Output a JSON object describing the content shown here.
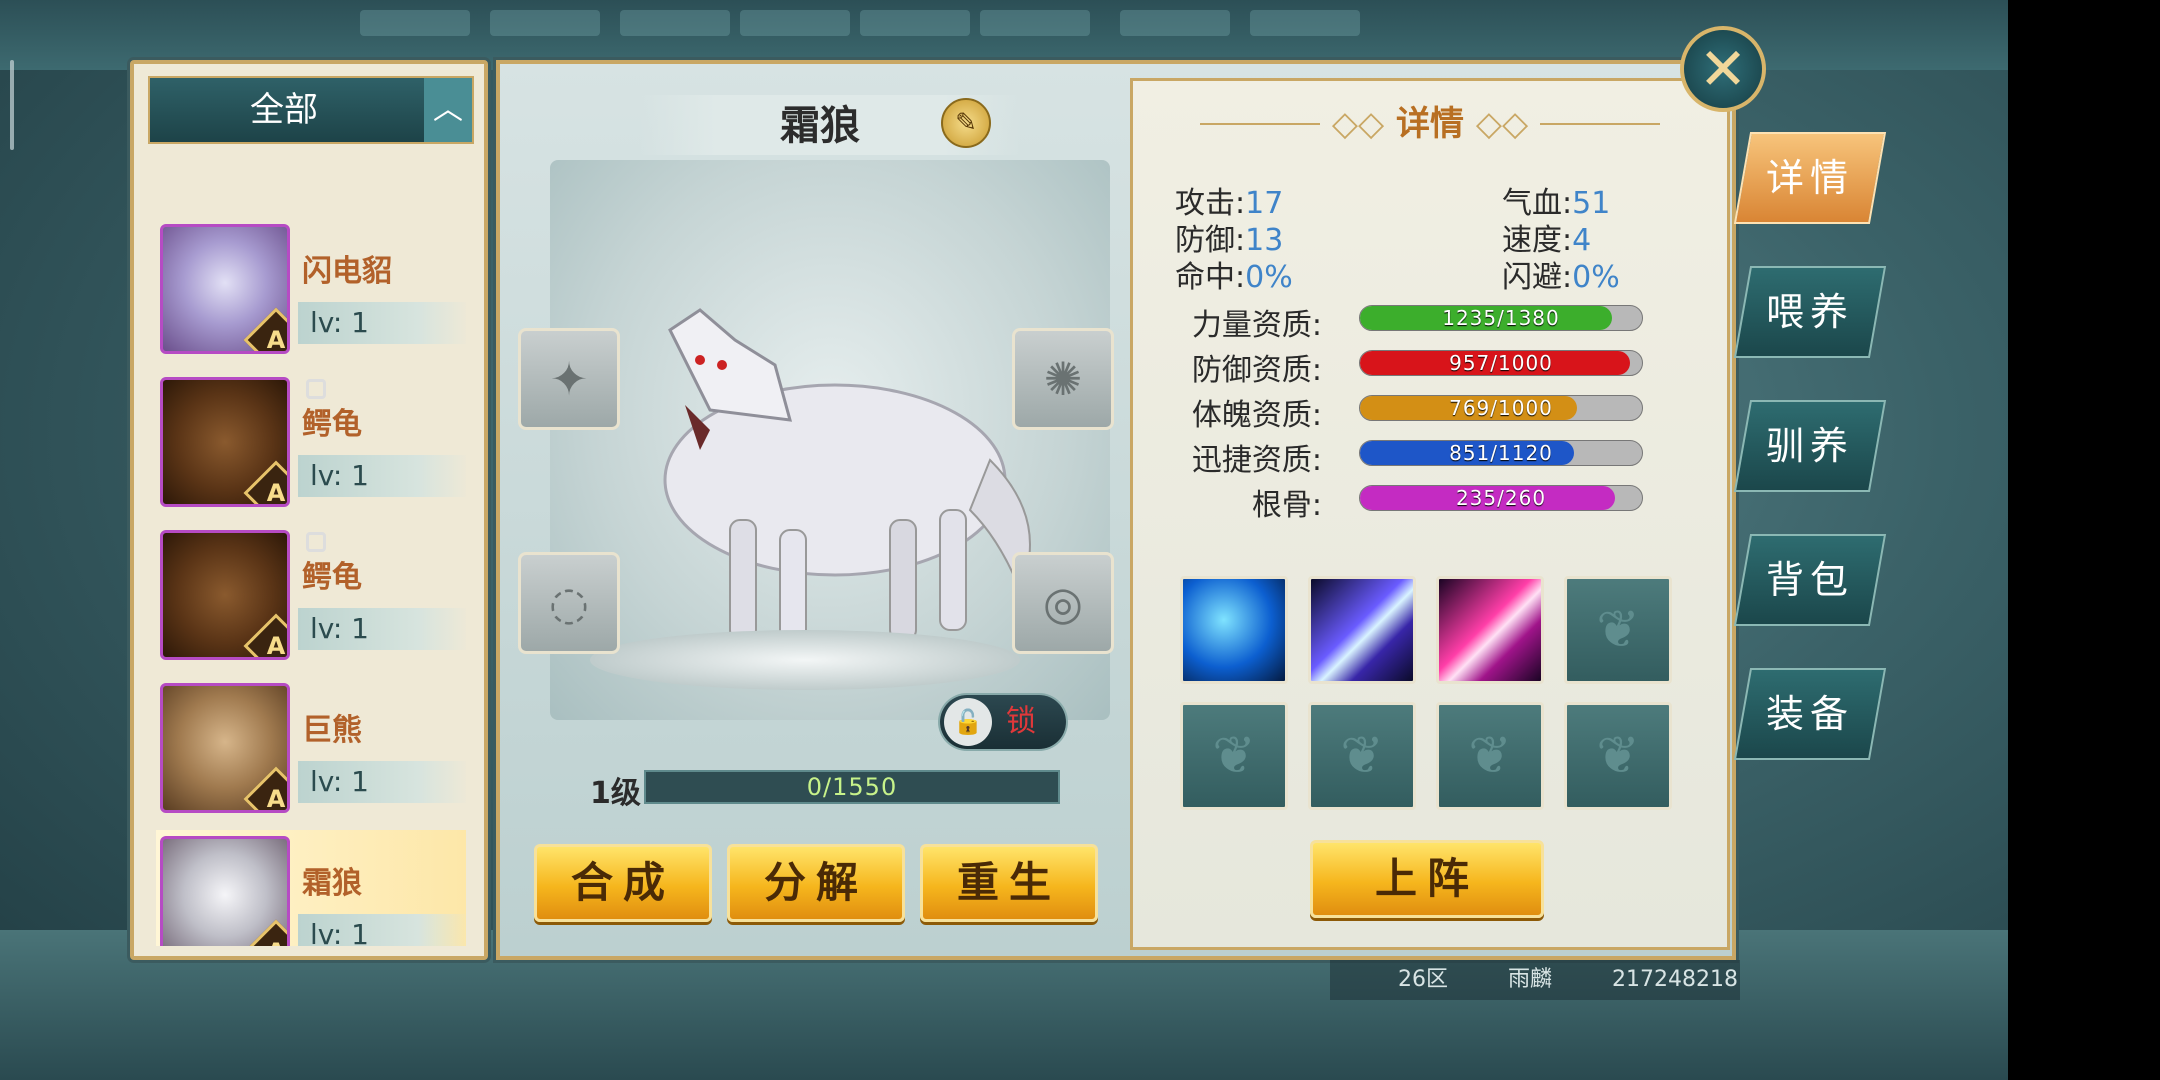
{
  "filter": {
    "label": "全部",
    "toggle_icon": "︿"
  },
  "pets": [
    {
      "name": "闪电貂",
      "level": "lv: 1",
      "grade": "A",
      "portrait": "p-purple",
      "locked": false,
      "selected": false
    },
    {
      "name": "鳄龟",
      "level": "lv: 1",
      "grade": "A",
      "portrait": "p-turtle",
      "locked": true,
      "selected": false
    },
    {
      "name": "鳄龟",
      "level": "lv: 1",
      "grade": "A",
      "portrait": "p-turtle",
      "locked": true,
      "selected": false
    },
    {
      "name": "巨熊",
      "level": "lv: 1",
      "grade": "A",
      "portrait": "p-bear",
      "locked": false,
      "selected": false
    },
    {
      "name": "霜狼",
      "level": "lv: 1",
      "grade": "A",
      "portrait": "p-wolf",
      "locked": false,
      "selected": true
    }
  ],
  "selected_pet": {
    "name": "霜狼",
    "level_label": "1级",
    "exp": "0/1550",
    "exp_fraction": 0,
    "lock_label": "锁"
  },
  "actions": {
    "compose": "合成",
    "decompose": "分解",
    "rebirth": "重生",
    "deploy": "上阵"
  },
  "details": {
    "title": "详情",
    "stats": {
      "attack_label": "攻击:",
      "attack": "17",
      "hp_label": "气血:",
      "hp": "51",
      "defense_label": "防御:",
      "defense": "13",
      "speed_label": "速度:",
      "speed": "4",
      "hit_label": "命中:",
      "hit": "0%",
      "dodge_label": "闪避:",
      "dodge": "0%"
    },
    "aptitudes": [
      {
        "label": "力量资质:",
        "text": "1235/1380",
        "fraction": 0.895,
        "color": "#3cae2c"
      },
      {
        "label": "防御资质:",
        "text": "957/1000",
        "fraction": 0.957,
        "color": "#d8141a"
      },
      {
        "label": "体魄资质:",
        "text": "769/1000",
        "fraction": 0.769,
        "color": "#d38f15"
      },
      {
        "label": "迅捷资质:",
        "text": "851/1120",
        "fraction": 0.76,
        "color": "#1e56c8"
      },
      {
        "label": "根骨:",
        "text": "235/260",
        "fraction": 0.904,
        "color": "#c42bc2"
      }
    ],
    "skills": [
      "frost-wolf-skill-icon",
      "purple-claw-skill-icon",
      "pink-claw-skill-icon",
      "empty",
      "empty",
      "empty",
      "empty",
      "empty"
    ]
  },
  "tabs": [
    "详情",
    "喂养",
    "驯养",
    "背包",
    "装备"
  ],
  "active_tab": 0,
  "footer": {
    "server": "26区",
    "player": "雨麟",
    "player_id": "217248218"
  }
}
